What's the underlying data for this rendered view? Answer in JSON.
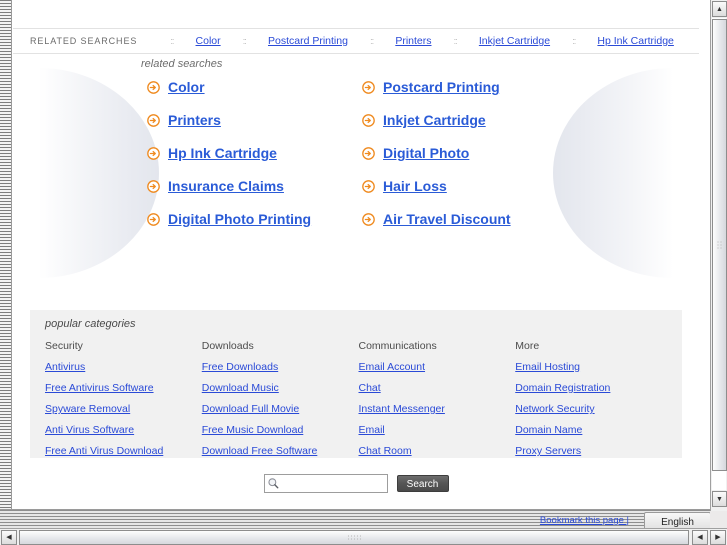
{
  "top_strip": {
    "label": "RELATED SEARCHES",
    "separator": "::",
    "links": [
      "Color",
      "Postcard Printing",
      "Printers",
      "Inkjet Cartridge",
      "Hp Ink Cartridge"
    ]
  },
  "related_searches": {
    "title": "related searches",
    "arrow_icon": "circle-arrow-right-icon",
    "items": [
      "Color",
      "Postcard Printing",
      "Printers",
      "Inkjet Cartridge",
      "Hp Ink Cartridge",
      "Digital Photo",
      "Insurance Claims",
      "Hair Loss",
      "Digital Photo Printing",
      "Air Travel Discount"
    ]
  },
  "popular_categories": {
    "title": "popular categories",
    "columns": [
      {
        "heading": "Security",
        "links": [
          "Antivirus",
          "Free Antivirus Software",
          "Spyware Removal",
          "Anti Virus Software",
          "Free Anti Virus Download"
        ]
      },
      {
        "heading": "Downloads",
        "links": [
          "Free Downloads",
          "Download Music",
          "Download Full Movie",
          "Free Music Download",
          "Download Free Software"
        ]
      },
      {
        "heading": "Communications",
        "links": [
          "Email Account",
          "Chat",
          "Instant Messenger",
          "Email",
          "Chat Room"
        ]
      },
      {
        "heading": "More",
        "links": [
          "Email Hosting",
          "Domain Registration",
          "Network Security",
          "Domain Name",
          "Proxy Servers"
        ]
      }
    ]
  },
  "search": {
    "icon": "magnifier-icon",
    "value": "",
    "placeholder": "",
    "button_label": "Search"
  },
  "footer": {
    "bookmark_label": "Bookmark this page |",
    "language_value": "English",
    "language_options": [
      "English"
    ]
  },
  "scrollbars": {
    "vertical": {
      "up_glyph": "▲",
      "down_glyph": "▼"
    },
    "horizontal": {
      "left_glyph": "◀",
      "right_glyph": "▶"
    }
  },
  "colors": {
    "link": "#2a4ad7",
    "heading_link": "#2a5bd7",
    "arrow_orange": "#f08a1e",
    "panel_bg": "#f1f1f1"
  }
}
